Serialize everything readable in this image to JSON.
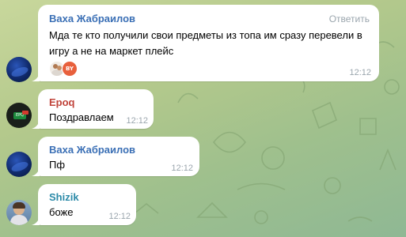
{
  "chat": {
    "messages": [
      {
        "sender": "Ваха Жабраилов",
        "sender_color": "#3a6fb5",
        "reply_label": "Ответить",
        "text_line1": "Мда те кто получили свои предметы из топа им сразу перевели в",
        "text_line2": "игру а не на маркет плейс",
        "time": "12:12",
        "reactions": {
          "avatars": [
            "reaction-avatar-photo",
            "reaction-avatar-badge"
          ],
          "badge_text": "BY"
        }
      },
      {
        "sender": "Epoq",
        "sender_color": "#c0433a",
        "text": "Поздравлаем",
        "time": "12:12"
      },
      {
        "sender": "Ваха Жабраилов",
        "sender_color": "#3a6fb5",
        "text": "Пф",
        "time": "12:12"
      },
      {
        "sender": "Shizik",
        "sender_color": "#2b8aa8",
        "text": "боже",
        "time": "12:12"
      }
    ]
  },
  "colors": {
    "bubble_bg": "#ffffff",
    "time_text": "#9aa5ad",
    "wallpaper_start": "#c8d79c",
    "wallpaper_end": "#8fb894"
  }
}
